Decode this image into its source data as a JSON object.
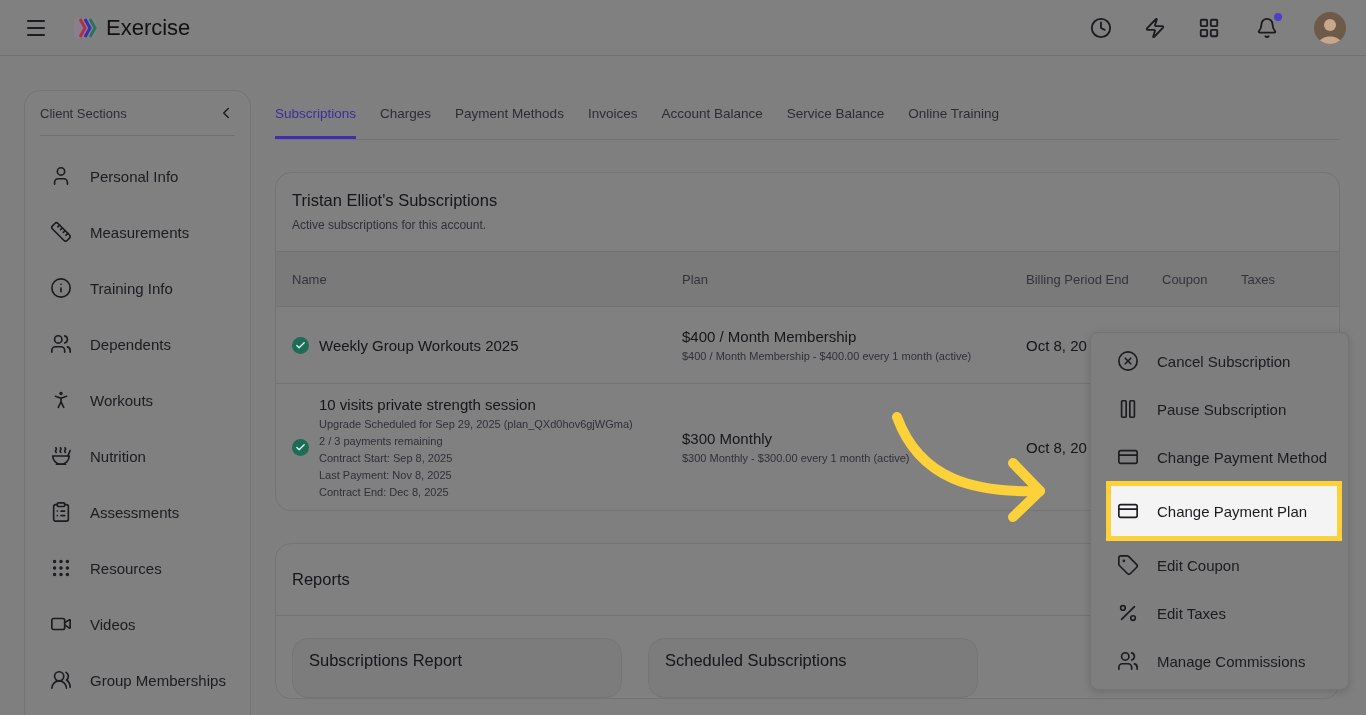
{
  "header": {
    "app_name": "Exercise"
  },
  "sidebar": {
    "title": "Client Sections",
    "items": [
      {
        "label": "Personal Info"
      },
      {
        "label": "Measurements"
      },
      {
        "label": "Training Info"
      },
      {
        "label": "Dependents"
      },
      {
        "label": "Workouts"
      },
      {
        "label": "Nutrition"
      },
      {
        "label": "Assessments"
      },
      {
        "label": "Resources"
      },
      {
        "label": "Videos"
      },
      {
        "label": "Group Memberships"
      }
    ]
  },
  "tabs": [
    {
      "label": "Subscriptions",
      "selected": true
    },
    {
      "label": "Charges",
      "selected": false
    },
    {
      "label": "Payment Methods",
      "selected": false
    },
    {
      "label": "Invoices",
      "selected": false
    },
    {
      "label": "Account Balance",
      "selected": false
    },
    {
      "label": "Service Balance",
      "selected": false
    },
    {
      "label": "Online Training",
      "selected": false
    }
  ],
  "subscriptions": {
    "title": "Tristan Elliot's Subscriptions",
    "subtitle": "Active subscriptions for this account.",
    "columns": [
      "Name",
      "Plan",
      "Billing Period End",
      "Coupon",
      "Taxes"
    ],
    "rows": [
      {
        "active": true,
        "name": "Weekly Group Workouts 2025",
        "details": [],
        "plan": "$400 / Month Membership",
        "plan_detail": "$400 / Month Membership - $400.00 every 1 month (active)",
        "billing_end": "Oct 8, 20"
      },
      {
        "active": true,
        "name": "10 visits private strength session",
        "details": [
          "Upgrade Scheduled for Sep 29, 2025 (plan_QXd0hov6gjWGma)",
          "2 / 3 payments remaining",
          "Contract Start: Sep 8, 2025",
          "Last Payment: Nov 8, 2025",
          "Contract End: Dec 8, 2025"
        ],
        "plan": "$300 Monthly",
        "plan_detail": "$300 Monthly - $300.00 every 1 month (active)",
        "billing_end": "Oct 8, 20"
      }
    ]
  },
  "reports": {
    "title": "Reports",
    "cards": [
      {
        "title": "Subscriptions Report"
      },
      {
        "title": "Scheduled Subscriptions"
      }
    ]
  },
  "context_menu": {
    "items": [
      {
        "label": "Cancel Subscription",
        "selected": false
      },
      {
        "label": "Pause Subscription",
        "selected": false
      },
      {
        "label": "Change Payment Method",
        "selected": false
      },
      {
        "label": "Change Payment Plan",
        "selected": true
      },
      {
        "label": "Edit Coupon",
        "selected": false
      },
      {
        "label": "Edit Taxes",
        "selected": false
      },
      {
        "label": "Manage Commissions",
        "selected": false
      }
    ]
  }
}
